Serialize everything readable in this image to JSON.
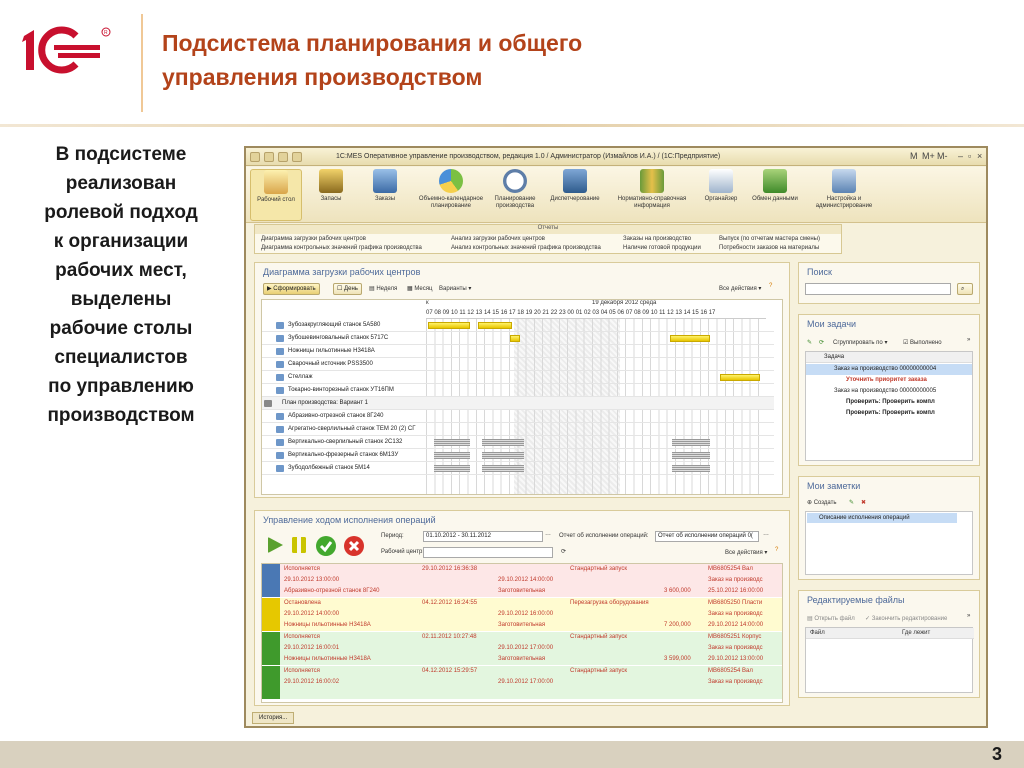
{
  "header": {
    "logo_text": "1С",
    "title_line1": "Подсистема планирования и общего",
    "title_line2": "управления производством"
  },
  "sidebar_text": [
    "В подсистеме",
    "реализован",
    "ролевой подход",
    "к организации",
    "рабочих мест,",
    "выделены",
    "рабочие столы",
    "специалистов",
    "по управлению",
    "производством"
  ],
  "page_number": "3",
  "colors": {
    "title": "#b3431a",
    "logo": "#c8102e",
    "panel_title": "#4e6a9a",
    "bar": "#f0d400",
    "row_red": "#fde7e7",
    "row_yellow": "#fffbd0",
    "row_green": "#e3f6df"
  },
  "app": {
    "window_title": "1С:MES Оперативное управление производством, редакция 1.0 / Администратор (Измайлов И.А.) / (1С:Предприятие)",
    "window_buttons": [
      "M",
      "M+",
      "M-"
    ],
    "ribbon": [
      {
        "label": "Рабочий стол",
        "icon": "desk-icon"
      },
      {
        "label": "Запасы",
        "icon": "stock-icon"
      },
      {
        "label": "Заказы",
        "icon": "truck-icon"
      },
      {
        "label": "Объемно-календарное планирование",
        "icon": "pie-icon"
      },
      {
        "label": "Планирование производства",
        "icon": "clock-icon"
      },
      {
        "label": "Диспетчерование",
        "icon": "toolbox-icon"
      },
      {
        "label": "Нормативно-справочная информация",
        "icon": "books-icon"
      },
      {
        "label": "Органайзер",
        "icon": "clipboard-icon"
      },
      {
        "label": "Обмен данными",
        "icon": "database-icon"
      },
      {
        "label": "Настройка и администрирование",
        "icon": "settings-icon"
      }
    ],
    "reports": {
      "header": "Отчеты",
      "items": [
        "Диаграмма загрузки рабочих центров",
        "Анализ загрузки рабочих центров",
        "Заказы на производство",
        "Выпуск (по отчетам мастера смены)",
        "Диаграмма контрольных значений графика производства",
        "Анализ контрольных значений графика производства",
        "Наличие готовой продукции",
        "Потребности заказов на материалы"
      ]
    },
    "gantt_panel": {
      "title": "Диаграмма загрузки рабочих центров",
      "btn_form": "Сформировать",
      "btn_day": "День",
      "btn_week": "Неделя",
      "btn_month": "Месяц",
      "btn_variants": "Варианты",
      "all_actions": "Все действия",
      "date_header": "19 декабря 2012 среда",
      "date_left": "к",
      "hours": "07 08 09 10 11 12 13 14 15 16 17 18 19 20 21 22 23 00 01 02 03 04 05 06 07 08 09 10 11 12 13 14 15 16 17",
      "rows": [
        {
          "label": "Зубозакругляющий станок 5А580",
          "group": false
        },
        {
          "label": "Зубошевинговальный станок 5717С",
          "group": false
        },
        {
          "label": "Ножницы гильотинные Н3418А",
          "group": false
        },
        {
          "label": "Сварочный источник PSS3500",
          "group": false
        },
        {
          "label": "Стеллаж",
          "group": false
        },
        {
          "label": "Токарно-винторезный станок УТ16ПМ",
          "group": false
        },
        {
          "label": "План производства: Вариант 1",
          "group": true
        },
        {
          "label": "Абразивно-отрезной станок 8Г240",
          "group": false
        },
        {
          "label": "Агрегатно-сверлильный станок ТЕМ 20 (2) СГ",
          "group": false
        },
        {
          "label": "Вертикально-сверлильный станок 2С132",
          "group": false
        },
        {
          "label": "Вертикально-фрезерный станок 6М13У",
          "group": false
        },
        {
          "label": "Зубодолбежный станок 5М14",
          "group": false
        }
      ]
    },
    "ops_panel": {
      "title": "Управление ходом исполнения операций",
      "period_label": "Период:",
      "period_value": "01.10.2012 - 30.11.2012",
      "workcenter_label": "Рабочий центр:",
      "report_label": "Отчет об исполнении операций:",
      "report_value": "Отчет об исполнении операций 0(",
      "all_actions": "Все действия",
      "rows": [
        {
          "status": "red",
          "c1": [
            "Исполняется",
            "29.10.2012 13:00:00",
            "Абразивно-отрезной станок 8Г240"
          ],
          "c2": [
            "29.10.2012 16:36:38",
            "",
            ""
          ],
          "c3": [
            "",
            "29.10.2012 14:00:00",
            "Заготовительная"
          ],
          "c4": [
            "Стандартный запуск",
            "",
            ""
          ],
          "c5": [
            "",
            "",
            "3 600,000"
          ],
          "c6": [
            "МВ6805254 Вал",
            "Заказ на производс",
            "25.10.2012 16:00:00"
          ]
        },
        {
          "status": "yellow",
          "c1": [
            "Остановлена",
            "29.10.2012 14:00:00",
            "Ножницы гильотинные Н3418А"
          ],
          "c2": [
            "04.12.2012 16:24:55",
            "",
            ""
          ],
          "c3": [
            "",
            "29.10.2012 16:00:00",
            "Заготовительная"
          ],
          "c4": [
            "Перезагрузка оборудования",
            "",
            ""
          ],
          "c5": [
            "",
            "",
            "7 200,000"
          ],
          "c6": [
            "МВ6805250 Пласти",
            "Заказ на производс",
            "29.10.2012 14:00:00"
          ]
        },
        {
          "status": "green",
          "c1": [
            "Исполняется",
            "29.10.2012 16:00:01",
            "Ножницы гильотинные Н3418А"
          ],
          "c2": [
            "02.11.2012 10:27:48",
            "",
            ""
          ],
          "c3": [
            "",
            "29.10.2012 17:00:00",
            "Заготовительная"
          ],
          "c4": [
            "Стандартный запуск",
            "",
            ""
          ],
          "c5": [
            "",
            "",
            "3 599,000"
          ],
          "c6": [
            "МВ6805251 Корпус",
            "Заказ на производс",
            "29.10.2012 13:00:00"
          ]
        },
        {
          "status": "green",
          "c1": [
            "Исполняется",
            "29.10.2012 16:00:02",
            ""
          ],
          "c2": [
            "04.12.2012 15:29:57",
            "",
            ""
          ],
          "c3": [
            "",
            "29.10.2012 17:00:00",
            ""
          ],
          "c4": [
            "Стандартный запуск",
            "",
            ""
          ],
          "c5": [
            "",
            "",
            ""
          ],
          "c6": [
            "МВ6805254 Вал",
            "Заказ на производс",
            ""
          ]
        }
      ]
    },
    "search_panel": {
      "title": "Поиск"
    },
    "tasks_panel": {
      "title": "Мои задачи",
      "group_btn": "Сгруппировать по",
      "done_btn": "Выполнено",
      "column": "Задача",
      "items": [
        {
          "text": "Заказ на производство 00000000004",
          "bold": false,
          "red": false,
          "indent": 0
        },
        {
          "text": "Уточнить приоритет заказа",
          "bold": true,
          "red": true,
          "indent": 1
        },
        {
          "text": "Заказ на производство 00000000005",
          "bold": false,
          "red": false,
          "indent": 0
        },
        {
          "text": "Проверить: Проверить компл",
          "bold": true,
          "red": false,
          "indent": 1
        },
        {
          "text": "Проверить: Проверить компл",
          "bold": true,
          "red": false,
          "indent": 1
        }
      ]
    },
    "notes_panel": {
      "title": "Мои заметки",
      "create_btn": "Создать",
      "note": "Описание исполнения операций"
    },
    "files_panel": {
      "title": "Редактируемые файлы",
      "open_btn": "Открыть файл",
      "finish_btn": "Закончить редактирование",
      "col_file": "Файл",
      "col_where": "Где лежит"
    },
    "history_tab": "История..."
  }
}
